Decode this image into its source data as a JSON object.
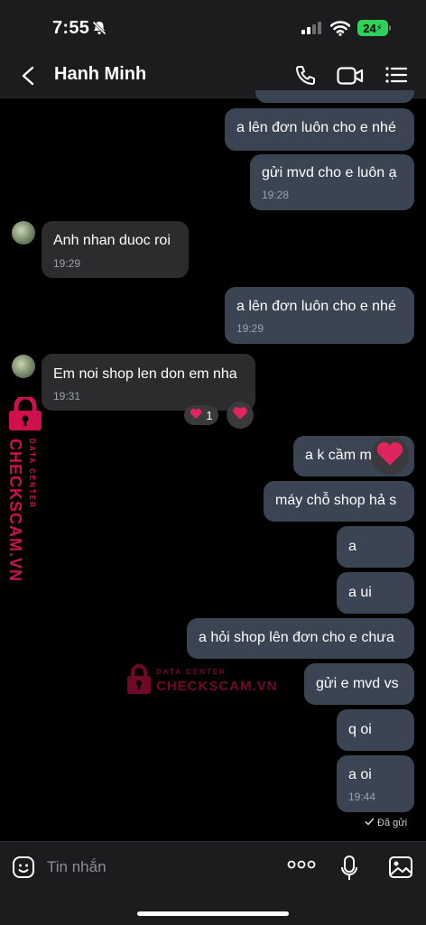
{
  "status": {
    "time": "7:55",
    "battery": "24"
  },
  "header": {
    "contact_name": "Hanh Minh"
  },
  "messages": [
    {
      "text": "a lên đơn luôn cho e nhé",
      "time": ""
    },
    {
      "text": "gửi mvd cho e luôn ạ",
      "time": "19:28"
    },
    {
      "text": "Anh nhan duoc roi",
      "time": "19:29"
    },
    {
      "text": "a lên đơn luôn cho e nhé",
      "time": "19:29"
    },
    {
      "text": "Em noi shop len don em nha",
      "time": "19:31"
    },
    {
      "text": "a k cầm m",
      "time": ""
    },
    {
      "text": "máy chỗ shop hả s",
      "time": ""
    },
    {
      "text": "a",
      "time": ""
    },
    {
      "text": "a ui",
      "time": ""
    },
    {
      "text": "a hỏi shop lên đơn cho e chưa",
      "time": ""
    },
    {
      "text": "gửi e mvd vs",
      "time": ""
    },
    {
      "text": "q oi",
      "time": ""
    },
    {
      "text": "a oi",
      "time": "19:44"
    }
  ],
  "reactions": {
    "count": "1"
  },
  "delivery_status": "Đã gửi",
  "composer": {
    "placeholder": "Tin nhắn"
  },
  "watermark": {
    "brand": "CHECKSCAM.VN",
    "sub": "DATA CENTER"
  },
  "colors": {
    "outgoing_bubble": "#3a4452",
    "incoming_bubble": "#2c2c2e",
    "heart": "#e0245e",
    "watermark": "#d0104c",
    "battery": "#30d158"
  }
}
